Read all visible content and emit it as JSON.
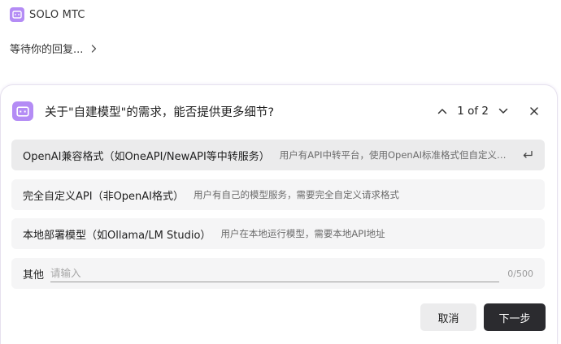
{
  "app": {
    "name": "SOLO MTC"
  },
  "status": {
    "waiting_text": "等待你的回复..."
  },
  "dialog": {
    "title": "关于\"自建模型\"的需求，能否提供更多细节?",
    "pager_text": "1 of 2",
    "options": [
      {
        "label": "OpenAI兼容格式（如OneAPI/NewAPI等中转服务）",
        "description": "用户有API中转平台，使用OpenAI标准格式但自定义端点",
        "selected": true
      },
      {
        "label": "完全自定义API（非OpenAI格式）",
        "description": "用户有自己的模型服务，需要完全自定义请求格式",
        "selected": false
      },
      {
        "label": "本地部署模型（如Ollama/LM Studio）",
        "description": "用户在本地运行模型，需要本地API地址",
        "selected": false
      }
    ],
    "other": {
      "label": "其他",
      "placeholder": "请输入",
      "value": "",
      "char_count": "0/500"
    },
    "buttons": {
      "cancel": "取消",
      "next": "下一步"
    }
  },
  "colors": {
    "brand_purple": "#b48cf5",
    "primary_button": "#2b2b2f",
    "secondary_button": "#ececed",
    "option_bg": "#f5f5f6",
    "option_selected_bg": "#ebebec"
  },
  "icons": {
    "app_logo": "terminal-box-icon",
    "waiting_arrow": "chevron-right-icon",
    "dialog_icon": "terminal-box-icon",
    "pager_prev": "chevron-up-icon",
    "pager_next": "chevron-down-icon",
    "close": "close-icon",
    "enter": "enter-key-icon"
  }
}
